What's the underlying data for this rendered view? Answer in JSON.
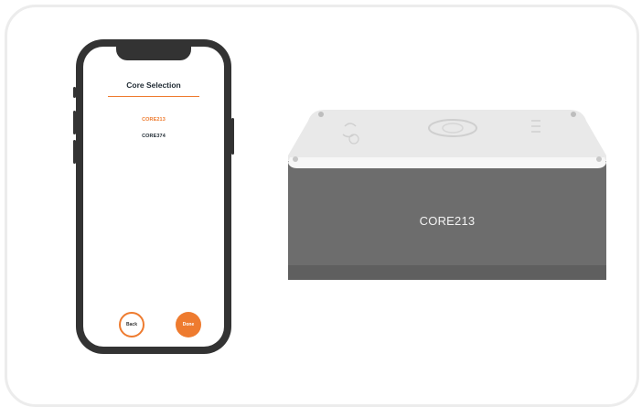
{
  "phone": {
    "screen_title": "Core Selection",
    "core_options": [
      {
        "label": "CORE213",
        "color": "#ee7b2f",
        "selected": true
      },
      {
        "label": "CORE374",
        "color": "#1f2a33",
        "selected": false
      }
    ],
    "back_label": "Back",
    "done_label": "Done"
  },
  "device": {
    "label": "CORE213",
    "body_color": "#6d6d6d",
    "top_color": "#e8e8e8"
  },
  "colors": {
    "accent": "#ee7b2f",
    "phone_frame": "#333333"
  }
}
